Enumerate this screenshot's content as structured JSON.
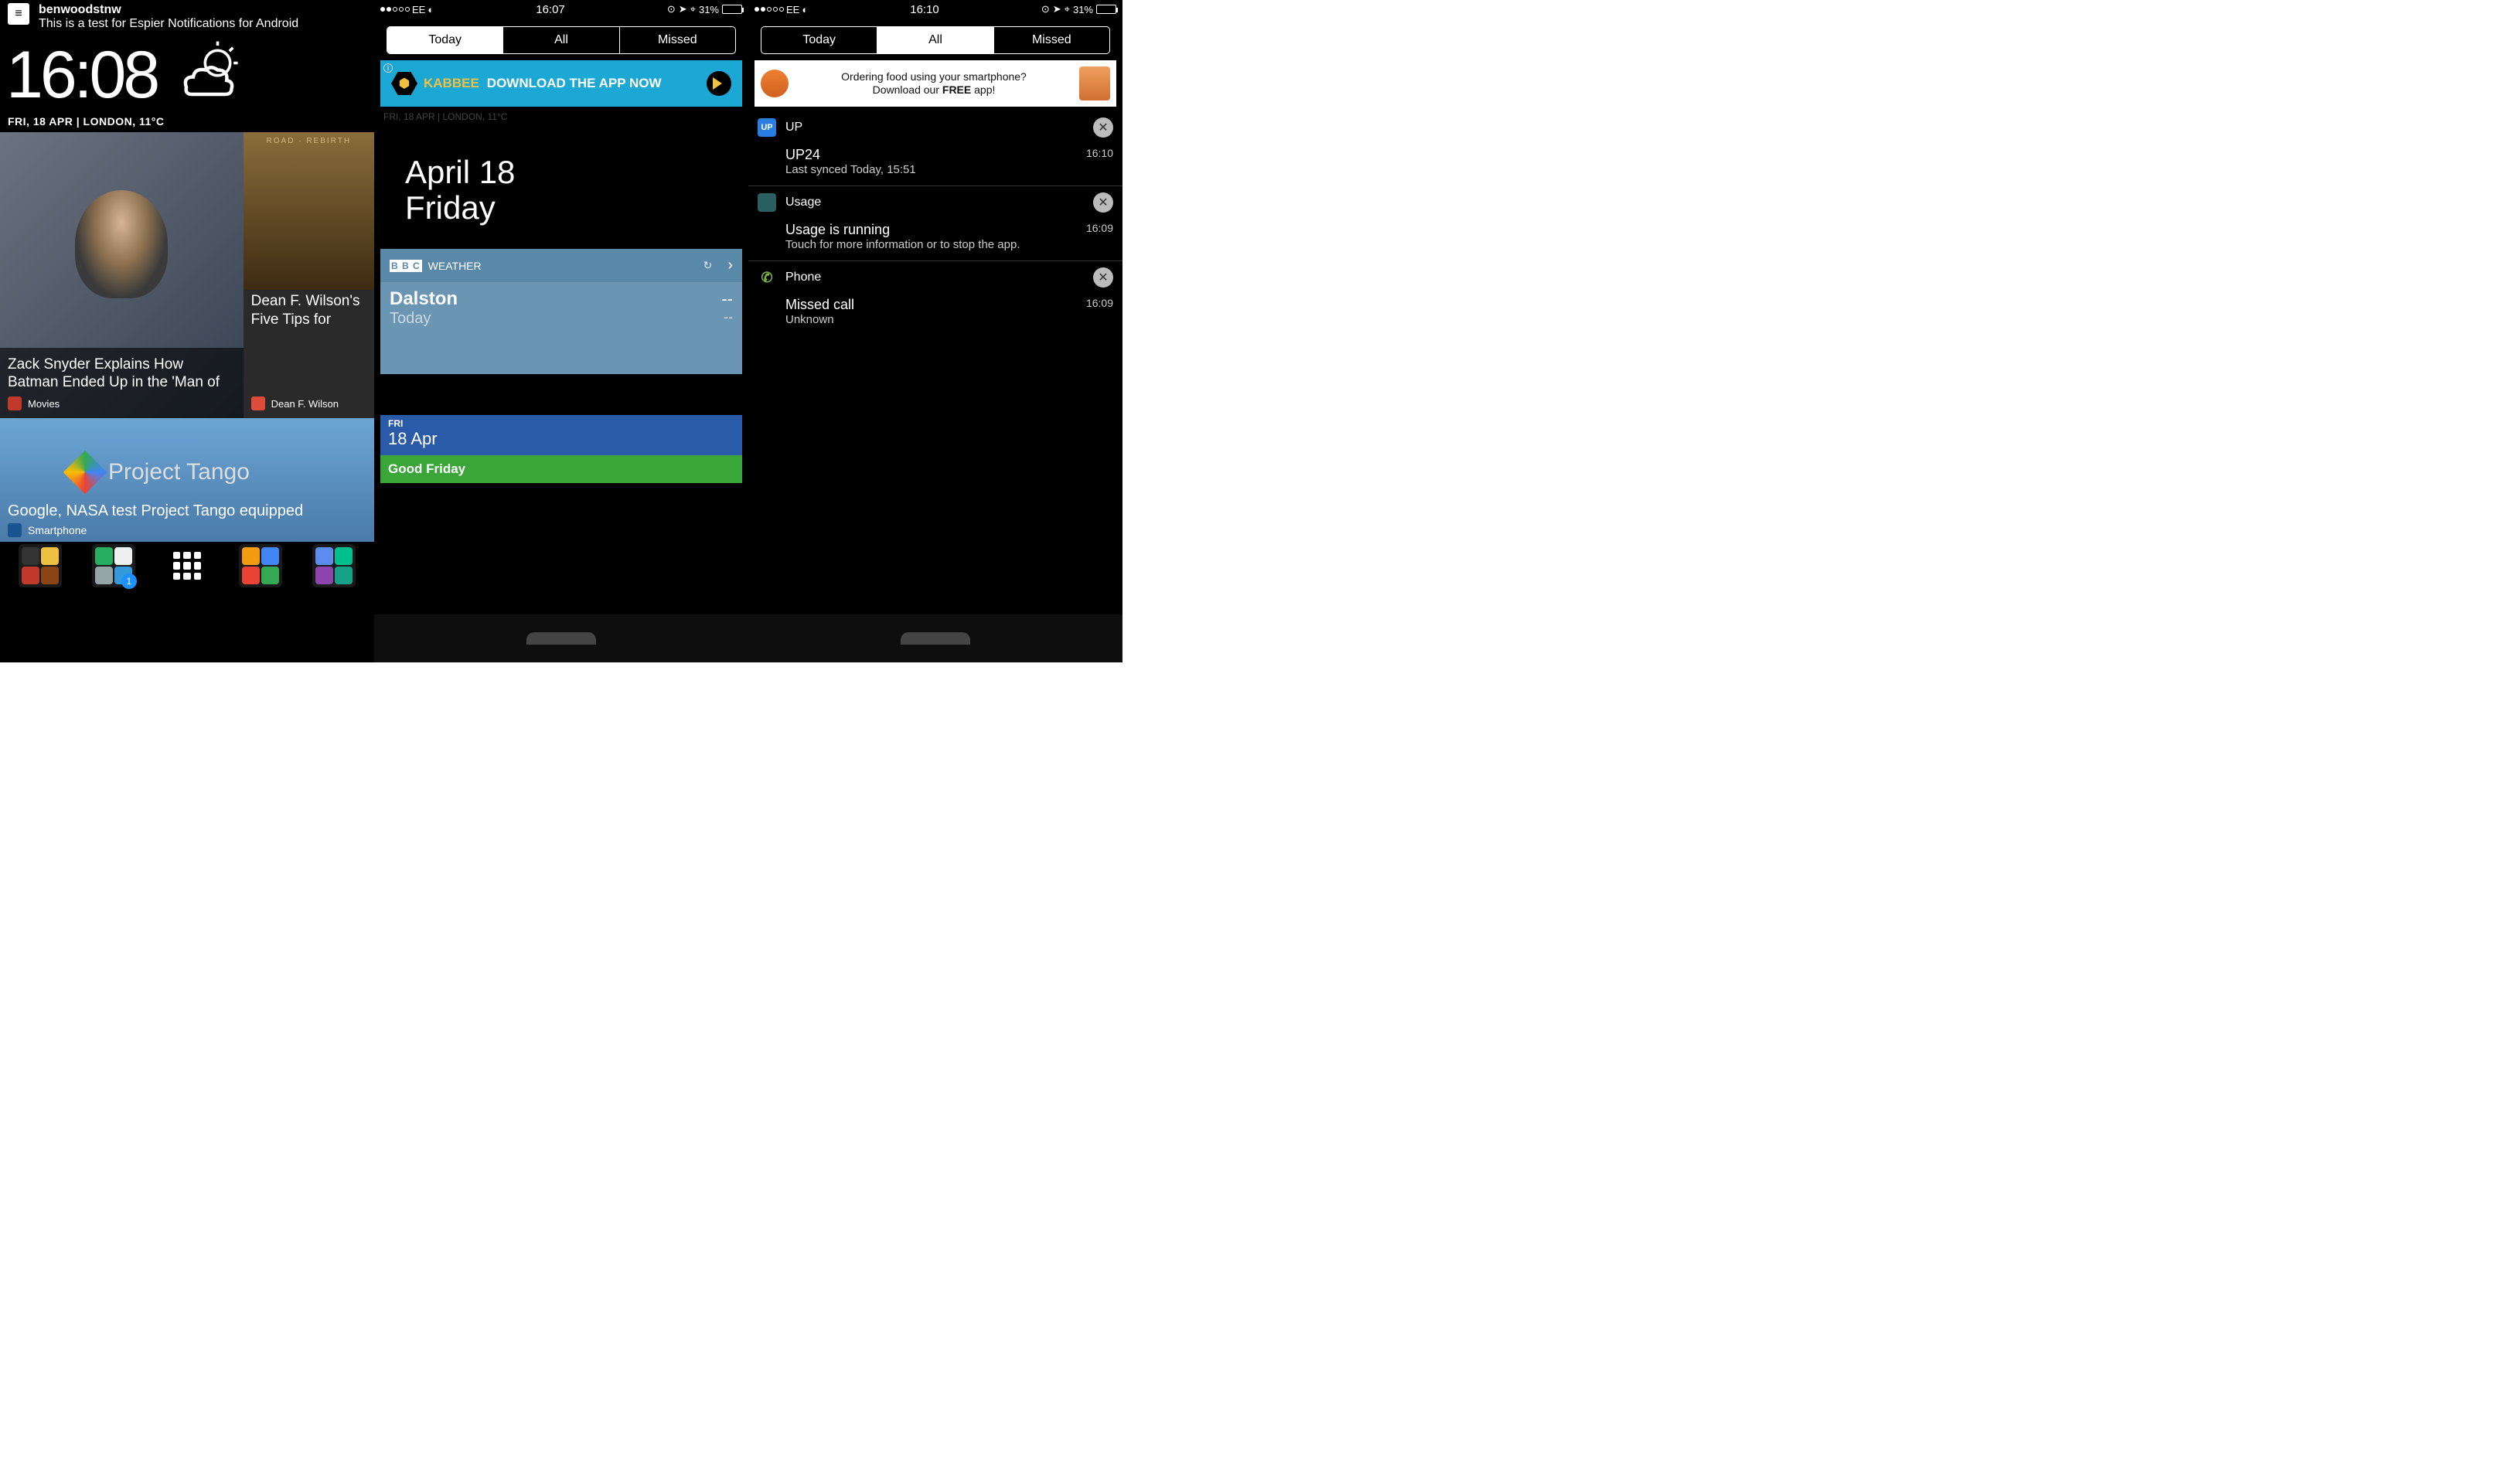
{
  "panel1": {
    "notif": {
      "user": "benwoodstnw",
      "text": "This is a test for Espier Notifications for Android"
    },
    "clock": "16:08",
    "dateline": "FRI, 18 APR  |  LONDON, 11°C",
    "tile_l_title": "Zack Snyder Explains How Batman Ended Up in the 'Man of",
    "tile_l_src": "Movies",
    "tile_r_poster": "ROAD · REBIRTH",
    "tile_r_title": "Dean F. Wilson's Five Tips for",
    "tile_r_src": "Dean F. Wilson",
    "tile_w_logo": "Project Tango",
    "tile_w_title": "Google, NASA test Project Tango equipped",
    "tile_w_src": "Smartphone",
    "dock_badge": "1"
  },
  "status": {
    "carrier": "EE",
    "battery": "31%"
  },
  "panel2": {
    "time": "16:07",
    "tabs": [
      "Today",
      "All",
      "Missed"
    ],
    "active_tab": 0,
    "ad": {
      "brand": "KABBEE",
      "text": "DOWNLOAD THE APP NOW"
    },
    "date_l1": "April 18",
    "date_l2": "Friday",
    "bbc": {
      "title": "WEATHER",
      "loc": "Dalston",
      "today": "Today",
      "v1": "--",
      "v2": "--"
    },
    "cal": {
      "fri": "FRI",
      "date": "18 Apr",
      "event": "Good Friday"
    },
    "bg_dateline": "FRI, 18 APR  |  LONDON, 11°C"
  },
  "panel3": {
    "time": "16:10",
    "tabs": [
      "Today",
      "All",
      "Missed"
    ],
    "active_tab": 1,
    "ad": {
      "l1": "Ordering food using your smartphone?",
      "l2": "Download our FREE app!"
    },
    "groups": [
      {
        "icon": "UP",
        "iconbg": "#2a7de1",
        "title": "UP",
        "body_t": "UP24",
        "body_s": "Last synced Today, 15:51",
        "time": "16:10"
      },
      {
        "icon": "",
        "iconbg": "#3aa0a0",
        "title": "Usage",
        "body_t": "Usage is running",
        "body_s": "Touch for more information or to stop the app.",
        "time": "16:09"
      },
      {
        "icon": "phone",
        "iconbg": "transparent",
        "title": "Phone",
        "body_t": "Missed call",
        "body_s": "Unknown",
        "time": "16:09"
      }
    ]
  }
}
